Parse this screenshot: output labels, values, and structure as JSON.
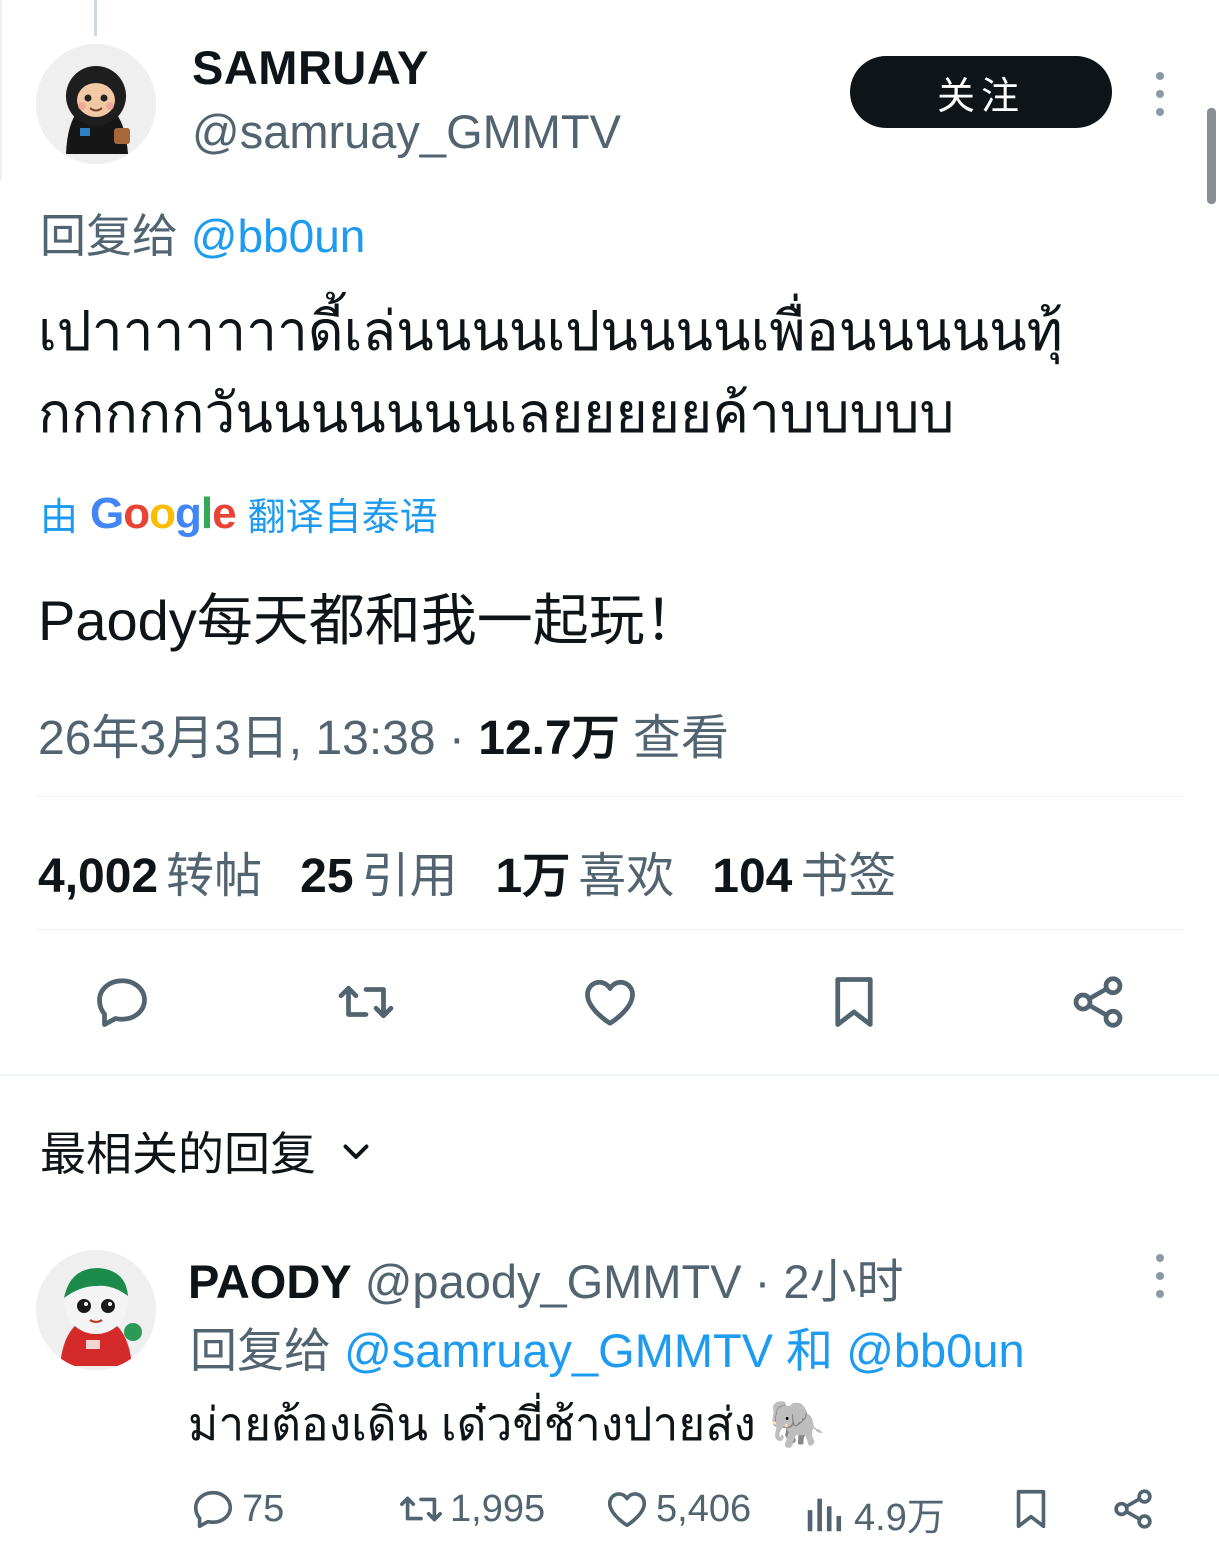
{
  "tweet": {
    "author_name": "SAMRUAY",
    "author_handle": "@samruay_GMMTV",
    "follow_label": "关注",
    "reply_to_prefix": "回复给",
    "reply_to_handle": "@bb0un",
    "text_line1": "เปาาาาาาาดี้เล่นนนนเปนนนนเพื่อนนนนนทุ้",
    "text_line2": "กกกกกวันนนนนนนเลยยยยยค้าบบบบบ",
    "translated_by_prefix": "由",
    "translated_by_brand": "Google",
    "translated_by_suffix": "翻译自泰语",
    "translation": "Paody每天都和我一起玩！",
    "datetime": "26年3月3日, 13:38",
    "views_value": "12.7万",
    "views_label": "查看"
  },
  "stats": {
    "retweets_value": "4,002",
    "retweets_label": "转帖",
    "quotes_value": "25",
    "quotes_label": "引用",
    "likes_value": "1万",
    "likes_label": "喜欢",
    "bookmarks_value": "104",
    "bookmarks_label": "书签"
  },
  "replies_sort": {
    "label": "最相关的回复"
  },
  "reply": {
    "author_name": "PAODY",
    "author_handle": "@paody_GMMTV",
    "time": "· 2小时",
    "reply_to_prefix": "回复给",
    "reply_to_handle1": "@samruay_GMMTV",
    "reply_to_and": "和",
    "reply_to_handle2": "@bb0un",
    "text": "ม่ายต้องเดิน เด๋วขี่ช้างปายส่ง 🐘",
    "replies_count": "75",
    "retweets_count": "1,995",
    "likes_count": "5,406",
    "views_count": "4.9万"
  },
  "icons": {
    "action_color": "#536471",
    "link_color": "#1d9bf0",
    "actions": [
      "reply-icon",
      "retweet-icon",
      "like-icon",
      "bookmark-icon",
      "share-icon",
      "views-icon",
      "more-icon",
      "chevron-down-icon"
    ]
  }
}
